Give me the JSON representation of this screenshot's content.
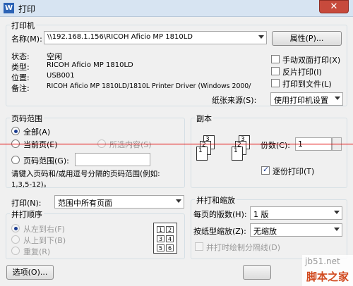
{
  "window": {
    "title": "打印",
    "app_icon": "W",
    "close": "✕"
  },
  "printer": {
    "group_title": "打印机",
    "name_label": "名称(M):",
    "name_value": "\\\\192.168.1.156\\RICOH Aficio MP 1810LD",
    "properties_button": "属性(P)...",
    "status_label": "状态:",
    "status_value": "空闲",
    "type_label": "类型:",
    "type_value": "RICOH Aficio MP 1810LD",
    "location_label": "位置:",
    "location_value": "USB001",
    "comment_label": "备注:",
    "comment_value": "RICOH Aficio MP 1810LD/1810L Printer Driver (Windows 2000/",
    "manual_duplex": "手动双面打印(X)",
    "reverse_print": "反片打印(I)",
    "print_to_file": "打印到文件(L)",
    "paper_source_label": "纸张来源(S):",
    "paper_source_value": "使用打印机设置"
  },
  "page_range": {
    "group_title": "页码范围",
    "all": "全部(A)",
    "current_page": "当前页(E)",
    "selection": "所选内容(S)",
    "pages": "页码范围(G):",
    "pages_value": "",
    "hint": "请键入页码和/或用逗号分隔的页码范围(例如:",
    "hint_example": "1,3,5-12)。"
  },
  "copies": {
    "group_title": "副本",
    "count_label": "份数(C):",
    "count_value": "1",
    "collate": "逐份打印(T)",
    "icon_pages": [
      "3",
      "2",
      "1",
      "3",
      "2",
      "1"
    ]
  },
  "print_what": {
    "label": "打印(N):",
    "value": "范围中所有页面"
  },
  "order": {
    "group_title": "并打顺序",
    "left_to_right": "从左到右(F)",
    "top_to_bottom": "从上到下(B)",
    "repeat": "重复(R)",
    "grid": [
      "1",
      "2",
      "3",
      "4",
      "5",
      "6"
    ]
  },
  "scale": {
    "group_title": "并打和缩放",
    "pages_per_sheet_label": "每页的版数(H):",
    "pages_per_sheet_value": "1 版",
    "scale_to_paper_label": "按纸型缩放(Z):",
    "scale_to_paper_value": "无缩放",
    "draw_borders": "并打时绘制分隔线(D)"
  },
  "footer": {
    "options_button": "选项(O)..."
  },
  "watermark": {
    "text": "jb51.net",
    "brand": "脚本之家"
  },
  "colors": {
    "accent_line": "#e30000",
    "close_red": "#c74a3c"
  }
}
